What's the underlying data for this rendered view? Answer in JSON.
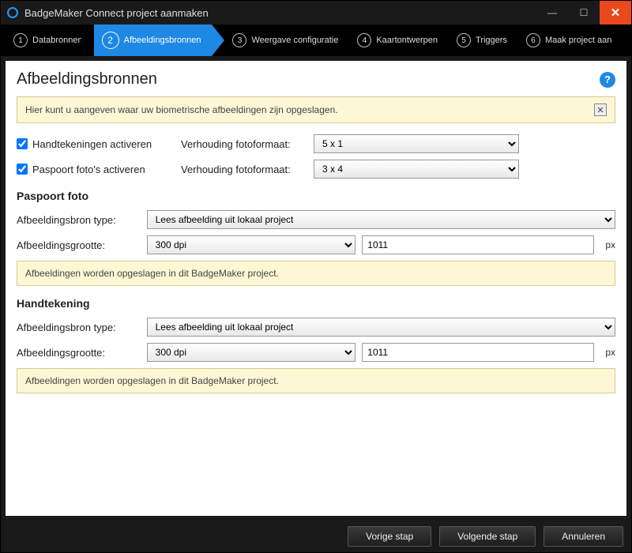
{
  "window": {
    "title": "BadgeMaker Connect project aanmaken"
  },
  "steps": [
    {
      "num": "1",
      "label": "Databronnen"
    },
    {
      "num": "2",
      "label": "Afbeeldingsbronnen"
    },
    {
      "num": "3",
      "label": "Weergave configuratie"
    },
    {
      "num": "4",
      "label": "Kaartontwerpen"
    },
    {
      "num": "5",
      "label": "Triggers"
    },
    {
      "num": "6",
      "label": "Maak project aan"
    }
  ],
  "page": {
    "heading": "Afbeeldingsbronnen",
    "help_glyph": "?",
    "info": "Hier kunt u aangeven waar uw biometrische afbeeldingen zijn opgeslagen.",
    "close_glyph": "✕"
  },
  "activate": {
    "signatures_label": "Handtekeningen activeren",
    "passport_label": "Paspoort foto's activeren",
    "ratio_label": "Verhouding fotoformaat:",
    "sig_ratio": "5 x 1",
    "pass_ratio": "3 x 4"
  },
  "sections": {
    "passport": {
      "title": "Paspoort foto",
      "source_label": "Afbeeldingsbron type:",
      "source_value": "Lees afbeelding uit lokaal project",
      "size_label": "Afbeeldingsgrootte:",
      "dpi_value": "300 dpi",
      "px_value": "1011",
      "px_unit": "px",
      "note": "Afbeeldingen worden opgeslagen in dit BadgeMaker project."
    },
    "signature": {
      "title": "Handtekening",
      "source_label": "Afbeeldingsbron type:",
      "source_value": "Lees afbeelding uit lokaal project",
      "size_label": "Afbeeldingsgrootte:",
      "dpi_value": "300 dpi",
      "px_value": "1011",
      "px_unit": "px",
      "note": "Afbeeldingen worden opgeslagen in dit BadgeMaker project."
    }
  },
  "footer": {
    "prev": "Vorige stap",
    "next": "Volgende stap",
    "cancel": "Annuleren"
  }
}
